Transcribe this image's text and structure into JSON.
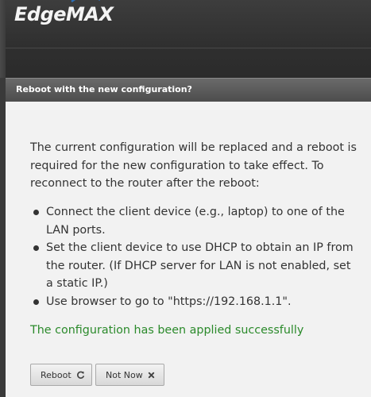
{
  "brand": {
    "name": "EdgeMAX",
    "registered_mark": "®"
  },
  "dialog": {
    "title": "Reboot with the new configuration?",
    "intro_lines": [
      "The current configuration will be replaced and a reboot is",
      "required for the new configuration to take effect. To",
      "reconnect to the router after the reboot:"
    ],
    "steps": [
      {
        "lines": [
          "Connect the client device (e.g., laptop) to one of the",
          "LAN ports."
        ]
      },
      {
        "lines": [
          "Set the client device to use DHCP to obtain an IP from",
          "the router. (If DHCP server for LAN is not enabled, set",
          "a static IP.)"
        ]
      },
      {
        "lines": [
          "Use browser to go to \"https://192.168.1.1\"."
        ]
      }
    ],
    "status_message": "The configuration has been applied successfully",
    "buttons": {
      "reboot_label": "Reboot",
      "reboot_icon": "refresh-icon",
      "not_now_label": "Not Now",
      "not_now_icon": "close-icon"
    }
  },
  "colors": {
    "header_bg": "#2f2f2f",
    "titlebar_bg": "#555555",
    "dialog_bg": "#f2f2f2",
    "success_text": "#2b8a2b",
    "body_text": "#333333"
  }
}
